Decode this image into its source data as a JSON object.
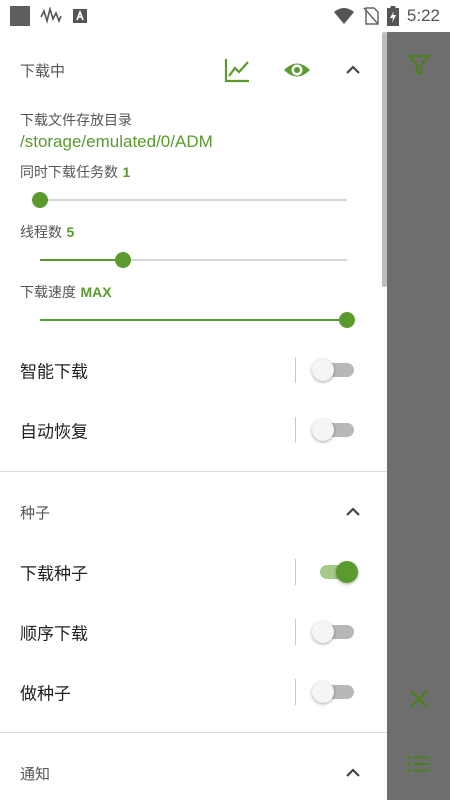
{
  "status_bar": {
    "time": "5:22"
  },
  "download_section": {
    "title": "下载中",
    "save_dir_label": "下载文件存放目录",
    "save_dir_value": "/storage/emulated/0/ADM",
    "concurrent_label": "同时下载任务数",
    "concurrent_value": "1",
    "concurrent_level": 0.0,
    "threads_label": "线程数",
    "threads_value": "5",
    "threads_level": 0.27,
    "speed_label": "下载速度",
    "speed_value": "MAX",
    "speed_level": 1.0,
    "smart_download_label": "智能下载",
    "smart_download_on": false,
    "auto_resume_label": "自动恢复",
    "auto_resume_on": false
  },
  "torrent_section": {
    "title": "种子",
    "download_torrent_label": "下载种子",
    "download_torrent_on": true,
    "sequential_label": "顺序下载",
    "sequential_on": false,
    "seeding_label": "做种子",
    "seeding_on": false
  },
  "notify_section": {
    "title": "通知"
  },
  "colors": {
    "accent": "#5a9a2e",
    "rail": "#6e6e6e"
  },
  "icons": [
    "chart-icon",
    "eye-icon",
    "chevron-up-icon",
    "filter-icon",
    "close-icon",
    "list-icon"
  ]
}
